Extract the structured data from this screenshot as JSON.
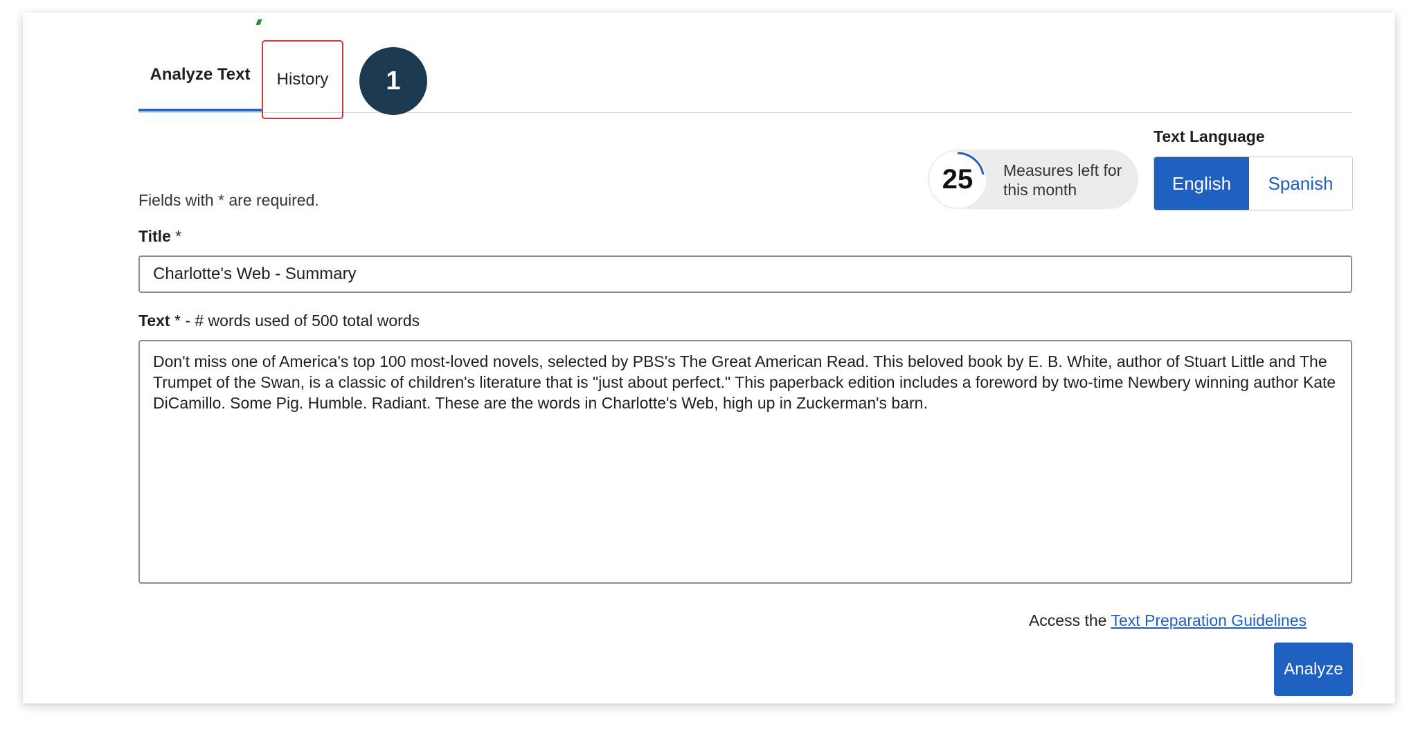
{
  "tabs": {
    "analyze_label": "Analyze Text",
    "history_label": "History"
  },
  "step_badge": "1",
  "language": {
    "label": "Text Language",
    "options": [
      "English",
      "Spanish"
    ],
    "selected": "English"
  },
  "measures": {
    "count": "25",
    "label": "Measures left for this month",
    "remaining_fraction": 0.13
  },
  "form": {
    "required_note": "Fields with * are required.",
    "title_label": "Title",
    "title_required_mark": " *",
    "title_value": "Charlotte's Web - Summary",
    "text_label": "Text",
    "text_label_suffix": " * -  # words used of 500 total words",
    "text_value": "Don't miss one of America's top 100 most-loved novels, selected by PBS's The Great American Read. This beloved book by E. B. White, author of Stuart Little and The Trumpet of the Swan, is a classic of children's literature that is \"just about perfect.\" This paperback edition includes a foreword by two-time Newbery winning author Kate DiCamillo. Some Pig. Humble. Radiant. These are the words in Charlotte's Web, high up in Zuckerman's barn."
  },
  "guidelines": {
    "prefix": "Access the ",
    "link": "Text Preparation Guidelines"
  },
  "analyze_button": "Analyze",
  "colors": {
    "accent": "#1f5fbf",
    "badge": "#1b3a52",
    "highlight": "#cc3b3b"
  }
}
